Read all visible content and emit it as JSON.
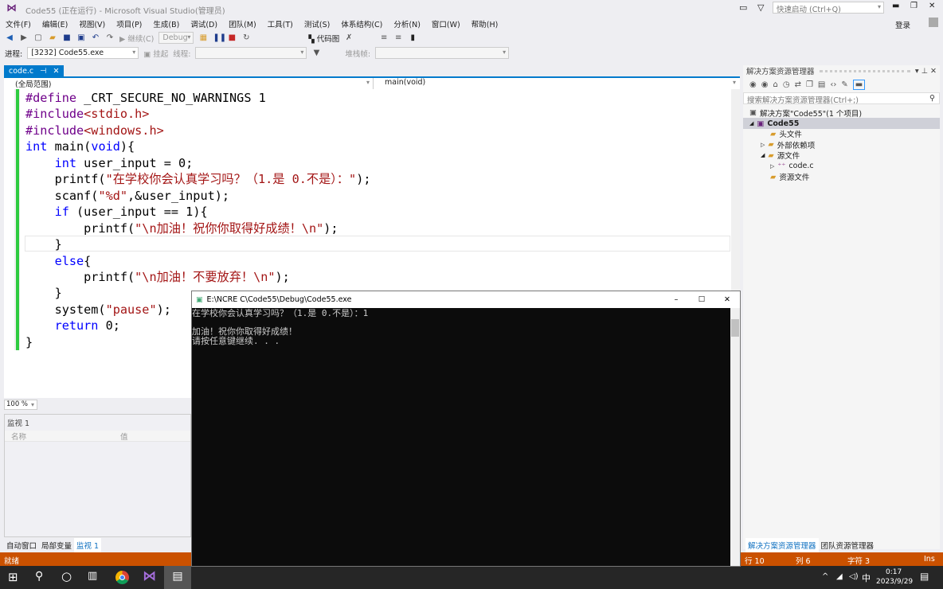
{
  "window": {
    "title": "Code55 (正在运行) - Microsoft Visual Studio(管理员)",
    "quick_launch": "快速启动 (Ctrl+Q)",
    "login": "登录"
  },
  "menu": [
    "文件(F)",
    "编辑(E)",
    "视图(V)",
    "项目(P)",
    "生成(B)",
    "调试(D)",
    "团队(M)",
    "工具(T)",
    "测试(S)",
    "体系结构(C)",
    "分析(N)",
    "窗口(W)",
    "帮助(H)"
  ],
  "toolbar": {
    "continue": "继续(C)",
    "config": "Debug",
    "code_map": "代码图",
    "process_label": "进程:",
    "process": "[3232] Code55.exe",
    "suspend": "挂起",
    "thread_label": "线程:",
    "stack_label": "堆栈帧:"
  },
  "editor": {
    "tab": "code.c",
    "scope": "(全局范围)",
    "member": "main(void)",
    "zoom": "100 %",
    "lines": [
      [
        [
          "pp",
          "#define"
        ],
        [
          "tx",
          " _CRT_SECURE_NO_WARNINGS 1"
        ]
      ],
      [
        [
          "pp",
          "#include"
        ],
        [
          "str",
          "<stdio.h>"
        ]
      ],
      [
        [
          "pp",
          "#include"
        ],
        [
          "str",
          "<windows.h>"
        ]
      ],
      [
        [
          "kw",
          "int"
        ],
        [
          "tx",
          " main("
        ],
        [
          "kw",
          "void"
        ],
        [
          "tx",
          "){"
        ]
      ],
      [
        [
          "tx",
          "    "
        ],
        [
          "kw",
          "int"
        ],
        [
          "tx",
          " user_input = 0;"
        ]
      ],
      [
        [
          "tx",
          "    printf("
        ],
        [
          "str",
          "\"在学校你会认真学习吗？（1.是 0.不是）：\""
        ],
        [
          "tx",
          ");"
        ]
      ],
      [
        [
          "tx",
          "    scanf("
        ],
        [
          "str",
          "\"%d\""
        ],
        [
          "tx",
          ",&user_input);"
        ]
      ],
      [
        [
          "tx",
          "    "
        ],
        [
          "kw",
          "if"
        ],
        [
          "tx",
          " (user_input == 1){"
        ]
      ],
      [
        [
          "tx",
          "        printf("
        ],
        [
          "str",
          "\"\\n加油！祝你你取得好成绩！\\n\""
        ],
        [
          "tx",
          ");"
        ]
      ],
      [
        [
          "tx",
          "    }"
        ]
      ],
      [
        [
          "tx",
          "    "
        ],
        [
          "kw",
          "else"
        ],
        [
          "tx",
          "{"
        ]
      ],
      [
        [
          "tx",
          "        printf("
        ],
        [
          "str",
          "\"\\n加油！不要放弃！\\n\""
        ],
        [
          "tx",
          ");"
        ]
      ],
      [
        [
          "tx",
          "    }"
        ]
      ],
      [
        [
          "tx",
          "    system("
        ],
        [
          "str",
          "\"pause\""
        ],
        [
          "tx",
          ");"
        ]
      ],
      [
        [
          "tx",
          "    "
        ],
        [
          "kw",
          "return"
        ],
        [
          "tx",
          " 0;"
        ]
      ],
      [
        [
          "tx",
          "}"
        ]
      ]
    ]
  },
  "watch": {
    "title": "监视 1",
    "col_name": "名称",
    "col_value": "值",
    "tabs": [
      "自动窗口",
      "局部变量",
      "监视 1"
    ]
  },
  "solution": {
    "title": "解决方案资源管理器",
    "search": "搜索解决方案资源管理器(Ctrl+;)",
    "items": [
      "解决方案\"Code55\"(1 个项目)",
      "Code55",
      "头文件",
      "外部依赖项",
      "源文件",
      "code.c",
      "资源文件"
    ],
    "tabs": [
      "解决方案资源管理器",
      "团队资源管理器"
    ]
  },
  "console": {
    "title": "E:\\NCRE C\\Code55\\Debug\\Code55.exe",
    "output": "在学校你会认真学习吗？（1.是 0.不是）：1\n\n加油！祝你你取得好成绩！\n请按任意键继续. . ."
  },
  "status": {
    "text": "就绪",
    "line": "行 10",
    "col": "列 6",
    "char": "字符 3",
    "mode": "Ins"
  },
  "taskbar": {
    "ime": "中",
    "time": "0:17",
    "date": "2023/9/29"
  },
  "colors": {
    "accent": "#007acc",
    "status": "#ca5100"
  }
}
